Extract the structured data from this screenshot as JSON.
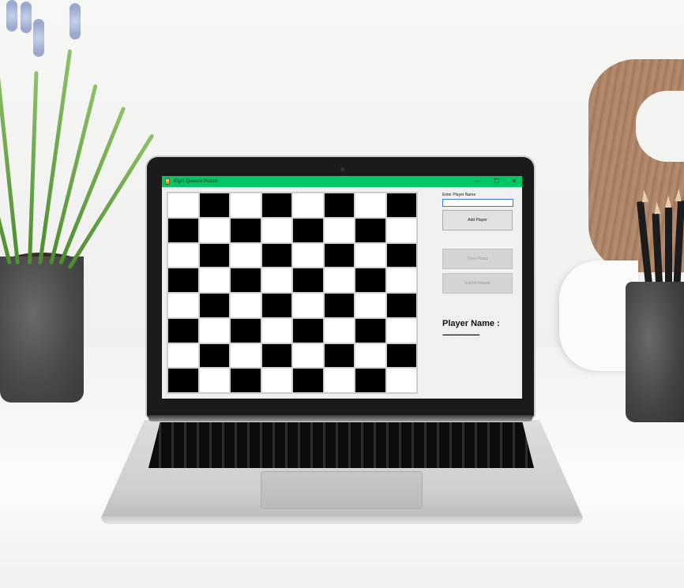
{
  "window": {
    "title": "Eight Queens Puzzle",
    "controls": {
      "minimize": "—",
      "maximize": "☐",
      "close": "✕"
    },
    "titlebar_color": "#00c765"
  },
  "board": {
    "rows": 8,
    "cols": 8,
    "first_cell": "light",
    "light_color": "#ffffff",
    "dark_color": "#000000"
  },
  "sidebar": {
    "enter_label": "Enter Player Name",
    "name_value": "",
    "add_button": "Add Player",
    "grow_button": "Grow Road",
    "submit_button": "Submit Answer",
    "player_label": "Player Name :",
    "player_value": "--------------------"
  }
}
